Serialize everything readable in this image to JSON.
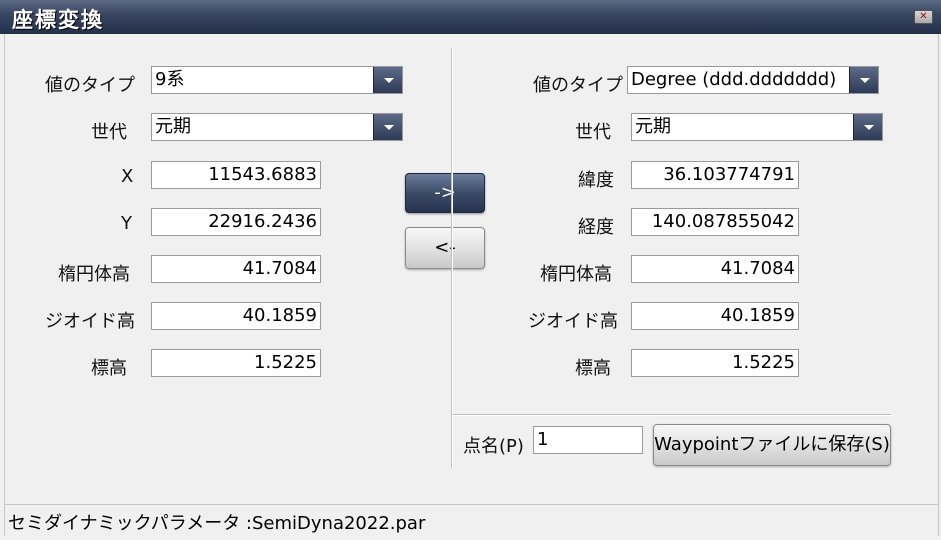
{
  "window": {
    "title": "座標変換",
    "close_glyph": "✕"
  },
  "left": {
    "value_type_label": "値のタイプ",
    "value_type": "9系",
    "generation_label": "世代",
    "generation": "元期",
    "x_label": "X",
    "x_value": "11543.6883",
    "y_label": "Y",
    "y_value": "22916.2436",
    "ellipsoid_height_label": "楕円体高",
    "ellipsoid_height": "41.7084",
    "geoid_height_label": "ジオイド高",
    "geoid_height": "40.1859",
    "elevation_label": "標高",
    "elevation": "1.5225"
  },
  "buttons": {
    "to_right": "->",
    "to_left": "<-"
  },
  "right": {
    "value_type_label": "値のタイプ",
    "value_type": "Degree (ddd.ddddddd)",
    "generation_label": "世代",
    "generation": "元期",
    "lat_label": "緯度",
    "lat_value": "36.103774791",
    "lon_label": "経度",
    "lon_value": "140.087855042",
    "ellipsoid_height_label": "楕円体高",
    "ellipsoid_height": "41.7084",
    "geoid_height_label": "ジオイド高",
    "geoid_height": "40.1859",
    "elevation_label": "標高",
    "elevation": "1.5225"
  },
  "point": {
    "name_label": "点名(P)",
    "name_value": "1",
    "save_button": "Waypointファイルに保存(S)"
  },
  "status": {
    "text": "セミダイナミックパラメータ :SemiDyna2022.par"
  },
  "colors": {
    "title_bar": "#2f3b56",
    "accent_button": "#3c4b68"
  }
}
